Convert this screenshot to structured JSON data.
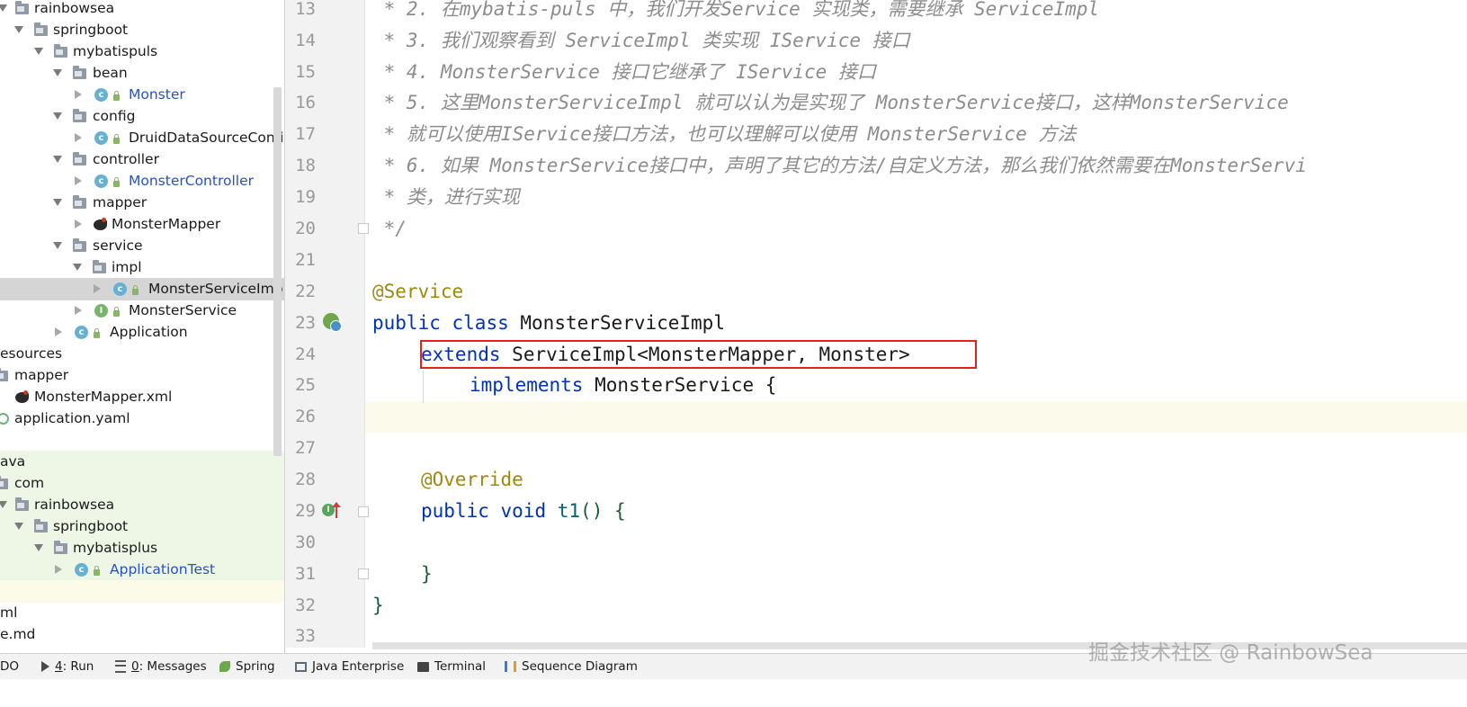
{
  "tree": {
    "items": [
      {
        "label": "rainbowsea",
        "icon": "folder-icon",
        "arrow": "down",
        "x_indent": "0"
      },
      {
        "label": "springboot",
        "icon": "folder-icon",
        "arrow": "down"
      },
      {
        "label": "mybatispuls",
        "icon": "folder-icon",
        "arrow": "down"
      },
      {
        "label": "bean",
        "icon": "folder-icon",
        "arrow": "down"
      },
      {
        "label": "Monster",
        "icon": "class-icon"
      },
      {
        "label": "config",
        "icon": "folder-icon",
        "arrow": "down"
      },
      {
        "label": "DruidDataSourceConfi",
        "icon": "class-icon"
      },
      {
        "label": "controller",
        "icon": "folder-icon",
        "arrow": "down"
      },
      {
        "label": "MonsterController",
        "icon": "class-icon"
      },
      {
        "label": "mapper",
        "icon": "folder-icon",
        "arrow": "down"
      },
      {
        "label": "MonsterMapper",
        "icon": "mybatis-icon"
      },
      {
        "label": "service",
        "icon": "folder-icon",
        "arrow": "down"
      },
      {
        "label": "impl",
        "icon": "folder-icon",
        "arrow": "down"
      },
      {
        "label": "MonsterServiceImp",
        "icon": "class-icon"
      },
      {
        "label": "MonsterService",
        "icon": "interface-icon"
      },
      {
        "label": "Application",
        "icon": "spring-class-icon"
      },
      {
        "label": "esources",
        "icon": ""
      },
      {
        "label": "mapper",
        "icon": "folder-icon"
      },
      {
        "label": "MonsterMapper.xml",
        "icon": "mybatis-icon"
      },
      {
        "label": "application.yaml",
        "icon": "yaml-icon"
      },
      {
        "label": "ava",
        "icon": ""
      },
      {
        "label": "com",
        "icon": "folder-icon"
      },
      {
        "label": "rainbowsea",
        "icon": "folder-icon",
        "arrow": "down"
      },
      {
        "label": "springboot",
        "icon": "folder-icon",
        "arrow": "down"
      },
      {
        "label": "mybatisplus",
        "icon": "folder-icon",
        "arrow": "down"
      },
      {
        "label": "ApplicationTest",
        "icon": "test-class-icon"
      },
      {
        "label": "",
        "icon": ""
      },
      {
        "label": "ml",
        "icon": ""
      },
      {
        "label": "e.md",
        "icon": ""
      }
    ]
  },
  "editor": {
    "line_numbers": [
      "13",
      "14",
      "15",
      "16",
      "17",
      "18",
      "19",
      "20",
      "21",
      "22",
      "23",
      "24",
      "25",
      "26",
      "27",
      "28",
      "29",
      "30",
      "31",
      "32",
      "33"
    ],
    "comments": {
      "l13": " * 2. 在mybatis-puls 中，我们开发Service 实现类，需要继承 ServiceImpl",
      "l14": " * 3. 我们观察看到 ServiceImpl 类实现 IService 接口",
      "l15": " * 4. MonsterService 接口它继承了 IService 接口",
      "l16": " * 5. 这里MonsterServiceImpl 就可以认为是实现了 MonsterService接口，这样MonsterService",
      "l17": " * 就可以使用IService接口方法，也可以理解可以使用 MonsterService 方法",
      "l18": " * 6. 如果 MonsterService接口中，声明了其它的方法/自定义方法，那么我们依然需要在MonsterServi",
      "l19": " * 类，进行实现",
      "l20": " */"
    },
    "code": {
      "l22_ann": "@Service",
      "l23_kw1": "public",
      "l23_kw2": "class",
      "l23_name": "MonsterServiceImpl",
      "l24_kw": "extends",
      "l24_rest": "ServiceImpl<MonsterMapper, Monster>",
      "l25_kw": "implements",
      "l25_rest": "MonsterService {",
      "l28_ann": "@Override",
      "l29_kw1": "public",
      "l29_kw2": "void",
      "l29_fn": "t1",
      "l29_rest": "() {",
      "l31": "}",
      "l32": "}"
    }
  },
  "bottom_bar": {
    "todo": "DO",
    "run_num": "4",
    "run_label": ": Run",
    "msg_num": "0",
    "msg_label": ": Messages",
    "spring": "Spring",
    "java_enterprise": "Java Enterprise",
    "terminal": "Terminal",
    "sequence": "Sequence Diagram"
  },
  "watermark": "掘金技术社区 @ RainbowSea",
  "colors": {
    "keyword": "#0033b3",
    "annotation": "#9e880d",
    "comment": "#8c8c8c",
    "highlight_box": "#e0231d",
    "selected_row": "#d5d5d5",
    "test_bg": "#eef7e6"
  }
}
